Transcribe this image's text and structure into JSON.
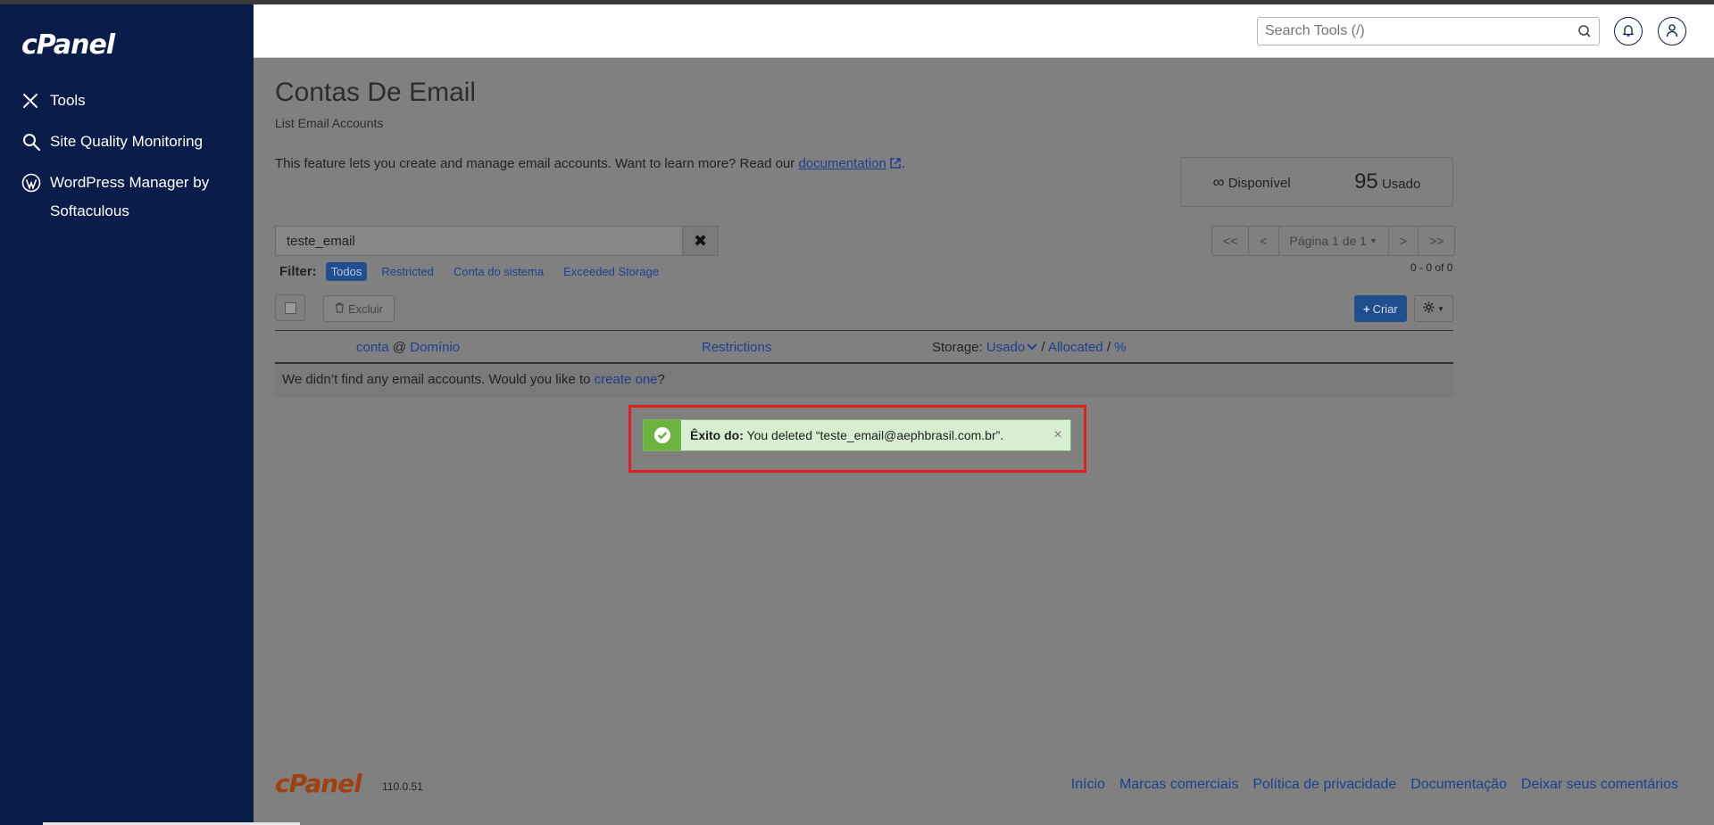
{
  "sidebar": {
    "logo": "cPanel",
    "items": [
      {
        "label": "Tools",
        "icon": "tools-icon"
      },
      {
        "label": "Site Quality Monitoring",
        "icon": "magnifier-icon"
      },
      {
        "label": "WordPress Manager by Softaculous",
        "icon": "wordpress-icon"
      }
    ]
  },
  "header": {
    "search_placeholder": "Search Tools (/)"
  },
  "page": {
    "title": "Contas De Email",
    "subtitle": "List Email Accounts",
    "description_prefix": "This feature lets you create and manage email accounts. Want to learn more? Read our",
    "description_link": "documentation",
    "description_suffix": "."
  },
  "stats": {
    "available_symbol": "∞",
    "available_label": "Disponível",
    "used_value": "95",
    "used_label": "Usado"
  },
  "filter": {
    "value": "teste_email",
    "clear_symbol": "✖",
    "label": "Filter:",
    "chips": [
      "Todos",
      "Restricted",
      "Conta do sistema",
      "Exceeded Storage"
    ]
  },
  "pager": {
    "first": "<<",
    "prev": "<",
    "page": "Página 1 de 1",
    "next": ">",
    "last": ">>",
    "count": "0 - 0 of 0"
  },
  "toolbar": {
    "delete_label": "Excluir",
    "create_label": "Criar"
  },
  "table": {
    "col_account": "conta",
    "col_at": "@",
    "col_domain": "Domínio",
    "col_restrictions": "Restrictions",
    "col_storage_label": "Storage:",
    "col_used": "Usado",
    "col_sep1": "/",
    "col_allocated": "Allocated",
    "col_sep2": "/",
    "col_percent": "%",
    "empty_prefix": "We didn’t find any email accounts. Would you like to",
    "empty_link": "create one",
    "empty_suffix": "?"
  },
  "alert": {
    "title": "Êxito do:",
    "message": "You deleted “teste_email@aephbrasil.com.br”.",
    "close": "×"
  },
  "footer": {
    "logo": "cPanel",
    "version": "110.0.51",
    "links": [
      "Início",
      "Marcas comerciais",
      "Política de privacidade",
      "Documentação",
      "Deixar seus comentários"
    ]
  },
  "colors": {
    "sidebar_bg": "#0a1d4a",
    "accent": "#1f4f8c",
    "success": "#6cb33f",
    "highlight": "#e01f1f"
  }
}
